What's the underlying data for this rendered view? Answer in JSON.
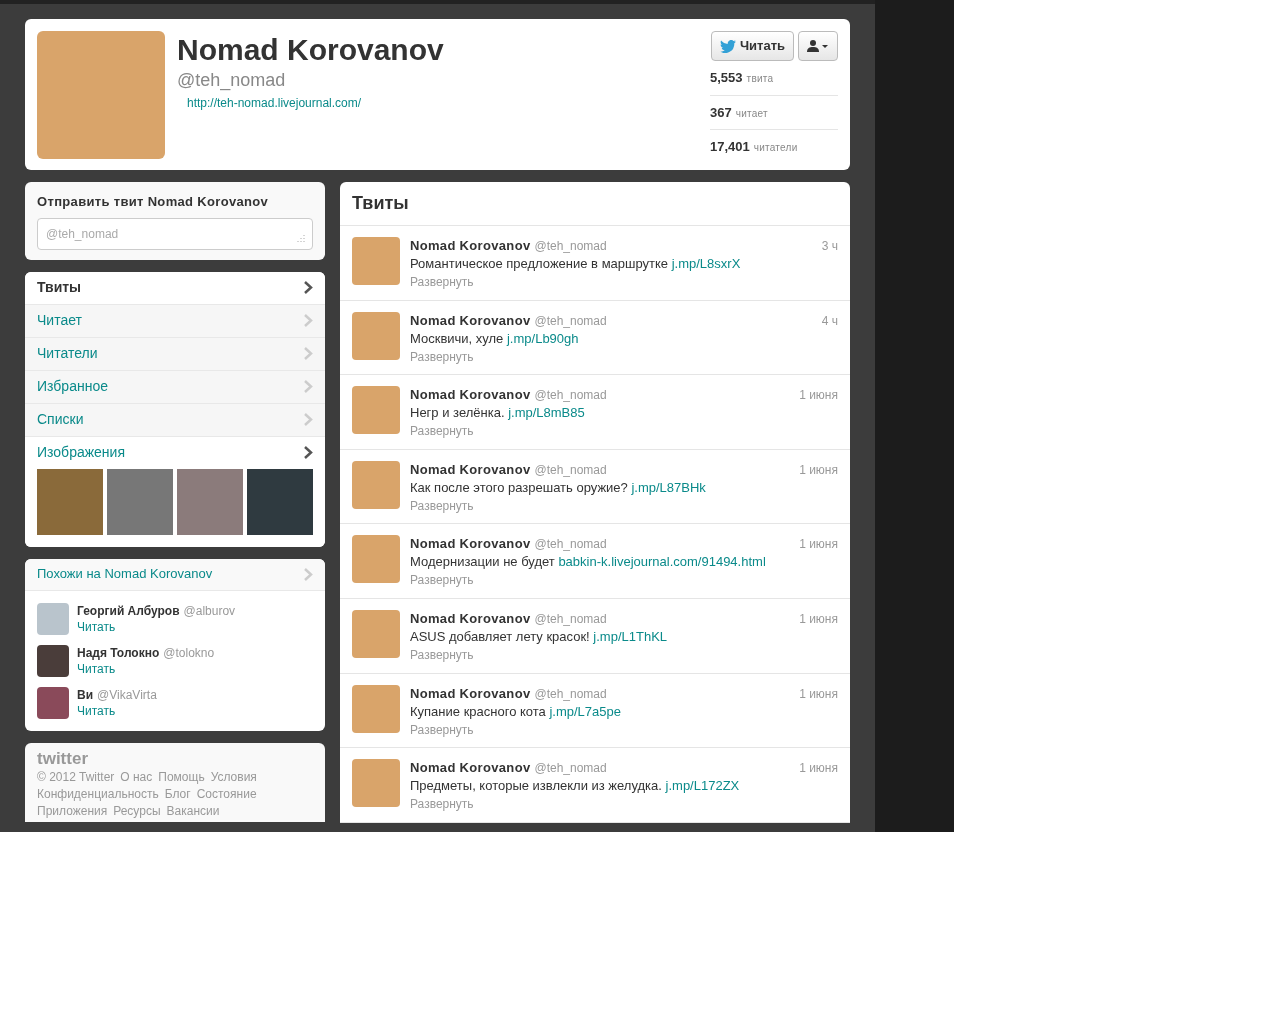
{
  "profile": {
    "name": "Nomad Korovanov",
    "handle": "@teh_nomad",
    "url": "http://teh-nomad.livejournal.com/",
    "follow_button": "Читать",
    "stats": [
      {
        "value": "5,553",
        "label": "твита"
      },
      {
        "value": "367",
        "label": "читает"
      },
      {
        "value": "17,401",
        "label": "читатели"
      }
    ]
  },
  "compose": {
    "title": "Отправить твит Nomad Korovanov",
    "placeholder": "@teh_nomad"
  },
  "nav": [
    {
      "label": "Твиты",
      "selected": true
    },
    {
      "label": "Читает",
      "selected": false
    },
    {
      "label": "Читатели",
      "selected": false
    },
    {
      "label": "Избранное",
      "selected": false
    },
    {
      "label": "Списки",
      "selected": false
    },
    {
      "label": "Изображения",
      "selected": false
    }
  ],
  "similar": {
    "title": "Похожи на Nomad Korovanov",
    "users": [
      {
        "name": "Георгий Албуров",
        "handle": "@alburov",
        "follow": "Читать"
      },
      {
        "name": "Надя Толокно",
        "handle": "@tolokno",
        "follow": "Читать"
      },
      {
        "name": "Ви",
        "handle": "@VikaVirta",
        "follow": "Читать"
      }
    ]
  },
  "footer": {
    "logo": "twitter",
    "links": [
      "© 2012 Twitter",
      "О нас",
      "Помощь",
      "Условия",
      "Конфиденциальность",
      "Блог",
      "Состояние",
      "Приложения",
      "Ресурсы",
      "Вакансии"
    ]
  },
  "timeline": {
    "title": "Твиты",
    "tweets": [
      {
        "name": "Nomad Korovanov",
        "handle": "@teh_nomad",
        "time": "3 ч",
        "text": "Романтическое предложение в маршрутке",
        "link": "j.mp/L8sxrX",
        "expand": "Развернуть"
      },
      {
        "name": "Nomad Korovanov",
        "handle": "@teh_nomad",
        "time": "4 ч",
        "text": "Москвичи, хуле",
        "link": "j.mp/Lb90gh",
        "expand": "Развернуть"
      },
      {
        "name": "Nomad Korovanov",
        "handle": "@teh_nomad",
        "time": "1 июня",
        "text": "Негр и зелёнка.",
        "link": "j.mp/L8mB85",
        "expand": "Развернуть"
      },
      {
        "name": "Nomad Korovanov",
        "handle": "@teh_nomad",
        "time": "1 июня",
        "text": "Как после этого разрешать оружие?",
        "link": "j.mp/L87BHk",
        "expand": "Развернуть"
      },
      {
        "name": "Nomad Korovanov",
        "handle": "@teh_nomad",
        "time": "1 июня",
        "text": "Модернизации не будет",
        "link": "babkin-k.livejournal.com/91494.html",
        "expand": "Развернуть"
      },
      {
        "name": "Nomad Korovanov",
        "handle": "@teh_nomad",
        "time": "1 июня",
        "text": "ASUS добавляет лету красок!",
        "link": "j.mp/L1ThKL",
        "expand": "Развернуть"
      },
      {
        "name": "Nomad Korovanov",
        "handle": "@teh_nomad",
        "time": "1 июня",
        "text": "Купание красного кота",
        "link": "j.mp/L7a5pe",
        "expand": "Развернуть"
      },
      {
        "name": "Nomad Korovanov",
        "handle": "@teh_nomad",
        "time": "1 июня",
        "text": "Предметы, которые извлекли из желудка.",
        "link": "j.mp/L172ZX",
        "expand": "Развернуть"
      }
    ]
  }
}
